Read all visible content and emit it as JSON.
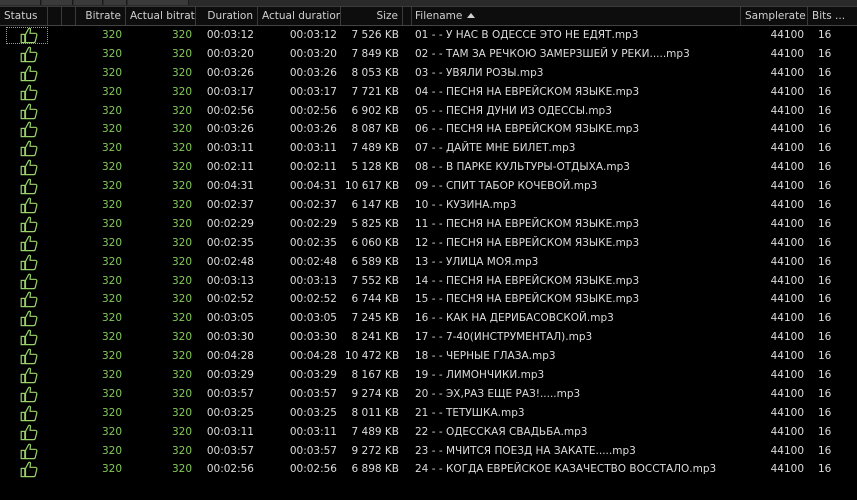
{
  "columns": {
    "status": "Status",
    "bitrate": "Bitrate",
    "actual_bitrate": "Actual bitrate",
    "duration": "Duration",
    "actual_duration": "Actual duration",
    "size": "Size",
    "filename": "Filename",
    "samplerate": "Samplerate",
    "bits": "Bits ..."
  },
  "status_icon": "thumbs-up-icon",
  "colors": {
    "green": "#83c95a",
    "text": "#dcdcdc",
    "background": "#000000"
  },
  "rows": [
    {
      "bitrate": "320",
      "actual_bitrate": "320",
      "duration": "00:03:12",
      "actual_duration": "00:03:12",
      "size": "7 526 KB",
      "filename": "01 -  - У НАС В ОДЕССЕ ЭТО НЕ ЕДЯТ.mp3",
      "samplerate": "44100",
      "bits": "16"
    },
    {
      "bitrate": "320",
      "actual_bitrate": "320",
      "duration": "00:03:20",
      "actual_duration": "00:03:20",
      "size": "7 849 KB",
      "filename": "02 -  - ТАМ ЗА РЕЧКОЮ ЗАМЕРЗШЕЙ У РЕКИ.....mp3",
      "samplerate": "44100",
      "bits": "16"
    },
    {
      "bitrate": "320",
      "actual_bitrate": "320",
      "duration": "00:03:26",
      "actual_duration": "00:03:26",
      "size": "8 053 KB",
      "filename": "03 -  - УВЯЛИ РОЗЫ.mp3",
      "samplerate": "44100",
      "bits": "16"
    },
    {
      "bitrate": "320",
      "actual_bitrate": "320",
      "duration": "00:03:17",
      "actual_duration": "00:03:17",
      "size": "7 721 KB",
      "filename": "04 -  - ПЕСНЯ НА ЕВРЕЙСКОМ ЯЗЫКЕ.mp3",
      "samplerate": "44100",
      "bits": "16"
    },
    {
      "bitrate": "320",
      "actual_bitrate": "320",
      "duration": "00:02:56",
      "actual_duration": "00:02:56",
      "size": "6 902 KB",
      "filename": "05 -  - ПЕСНЯ ДУНИ ИЗ ОДЕССЫ.mp3",
      "samplerate": "44100",
      "bits": "16"
    },
    {
      "bitrate": "320",
      "actual_bitrate": "320",
      "duration": "00:03:26",
      "actual_duration": "00:03:26",
      "size": "8 087 KB",
      "filename": "06 -  - ПЕСНЯ НА ЕВРЕЙСКОМ ЯЗЫКЕ.mp3",
      "samplerate": "44100",
      "bits": "16"
    },
    {
      "bitrate": "320",
      "actual_bitrate": "320",
      "duration": "00:03:11",
      "actual_duration": "00:03:11",
      "size": "7 489 KB",
      "filename": "07 -  - ДАЙТЕ МНЕ БИЛЕТ.mp3",
      "samplerate": "44100",
      "bits": "16"
    },
    {
      "bitrate": "320",
      "actual_bitrate": "320",
      "duration": "00:02:11",
      "actual_duration": "00:02:11",
      "size": "5 128 KB",
      "filename": "08 -  - В ПАРКЕ КУЛЬТУРЫ-ОТДЫХА.mp3",
      "samplerate": "44100",
      "bits": "16"
    },
    {
      "bitrate": "320",
      "actual_bitrate": "320",
      "duration": "00:04:31",
      "actual_duration": "00:04:31",
      "size": "10 617 KB",
      "filename": "09 -  - СПИТ ТАБОР КОЧЕВОЙ.mp3",
      "samplerate": "44100",
      "bits": "16"
    },
    {
      "bitrate": "320",
      "actual_bitrate": "320",
      "duration": "00:02:37",
      "actual_duration": "00:02:37",
      "size": "6 147 KB",
      "filename": "10 -  - КУЗИНА.mp3",
      "samplerate": "44100",
      "bits": "16"
    },
    {
      "bitrate": "320",
      "actual_bitrate": "320",
      "duration": "00:02:29",
      "actual_duration": "00:02:29",
      "size": "5 825 KB",
      "filename": "11 -  - ПЕСНЯ НА ЕВРЕЙСКОМ ЯЗЫКЕ.mp3",
      "samplerate": "44100",
      "bits": "16"
    },
    {
      "bitrate": "320",
      "actual_bitrate": "320",
      "duration": "00:02:35",
      "actual_duration": "00:02:35",
      "size": "6 060 KB",
      "filename": "12 -  - ПЕСНЯ НА ЕВРЕЙСКОМ ЯЗЫКЕ.mp3",
      "samplerate": "44100",
      "bits": "16"
    },
    {
      "bitrate": "320",
      "actual_bitrate": "320",
      "duration": "00:02:48",
      "actual_duration": "00:02:48",
      "size": "6 589 KB",
      "filename": "13 -  - УЛИЦА МОЯ.mp3",
      "samplerate": "44100",
      "bits": "16"
    },
    {
      "bitrate": "320",
      "actual_bitrate": "320",
      "duration": "00:03:13",
      "actual_duration": "00:03:13",
      "size": "7 552 KB",
      "filename": "14 -  - ПЕСНЯ НА ЕВРЕЙСКОМ ЯЗЫКЕ.mp3",
      "samplerate": "44100",
      "bits": "16"
    },
    {
      "bitrate": "320",
      "actual_bitrate": "320",
      "duration": "00:02:52",
      "actual_duration": "00:02:52",
      "size": "6 744 KB",
      "filename": "15 -  - ПЕСНЯ НА ЕВРЕЙСКОМ ЯЗЫКЕ.mp3",
      "samplerate": "44100",
      "bits": "16"
    },
    {
      "bitrate": "320",
      "actual_bitrate": "320",
      "duration": "00:03:05",
      "actual_duration": "00:03:05",
      "size": "7 245 KB",
      "filename": "16 -  - КАК НА ДЕРИБАСОВСКОЙ.mp3",
      "samplerate": "44100",
      "bits": "16"
    },
    {
      "bitrate": "320",
      "actual_bitrate": "320",
      "duration": "00:03:30",
      "actual_duration": "00:03:30",
      "size": "8 241 KB",
      "filename": "17 -  - 7-40(ИНСТРУМЕНТАЛ).mp3",
      "samplerate": "44100",
      "bits": "16"
    },
    {
      "bitrate": "320",
      "actual_bitrate": "320",
      "duration": "00:04:28",
      "actual_duration": "00:04:28",
      "size": "10 472 KB",
      "filename": "18 -  - ЧЕРНЫЕ ГЛАЗА.mp3",
      "samplerate": "44100",
      "bits": "16"
    },
    {
      "bitrate": "320",
      "actual_bitrate": "320",
      "duration": "00:03:29",
      "actual_duration": "00:03:29",
      "size": "8 167 KB",
      "filename": "19 -  - ЛИМОНЧИКИ.mp3",
      "samplerate": "44100",
      "bits": "16"
    },
    {
      "bitrate": "320",
      "actual_bitrate": "320",
      "duration": "00:03:57",
      "actual_duration": "00:03:57",
      "size": "9 274 KB",
      "filename": "20 -  - ЭХ,РАЗ ЕЩЕ РАЗ!.....mp3",
      "samplerate": "44100",
      "bits": "16"
    },
    {
      "bitrate": "320",
      "actual_bitrate": "320",
      "duration": "00:03:25",
      "actual_duration": "00:03:25",
      "size": "8 011 KB",
      "filename": "21 -  - ТЕТУШКА.mp3",
      "samplerate": "44100",
      "bits": "16"
    },
    {
      "bitrate": "320",
      "actual_bitrate": "320",
      "duration": "00:03:11",
      "actual_duration": "00:03:11",
      "size": "7 489 KB",
      "filename": "22 -  - ОДЕССКАЯ СВАДЬБА.mp3",
      "samplerate": "44100",
      "bits": "16"
    },
    {
      "bitrate": "320",
      "actual_bitrate": "320",
      "duration": "00:03:57",
      "actual_duration": "00:03:57",
      "size": "9 272 KB",
      "filename": "23 -  - МЧИТСЯ ПОЕЗД НА ЗАКАТЕ.....mp3",
      "samplerate": "44100",
      "bits": "16"
    },
    {
      "bitrate": "320",
      "actual_bitrate": "320",
      "duration": "00:02:56",
      "actual_duration": "00:02:56",
      "size": "6 898 KB",
      "filename": "24 -  - КОГДА ЕВРЕЙСКОЕ КАЗАЧЕСТВО ВОССТАЛО.mp3",
      "samplerate": "44100",
      "bits": "16"
    }
  ]
}
